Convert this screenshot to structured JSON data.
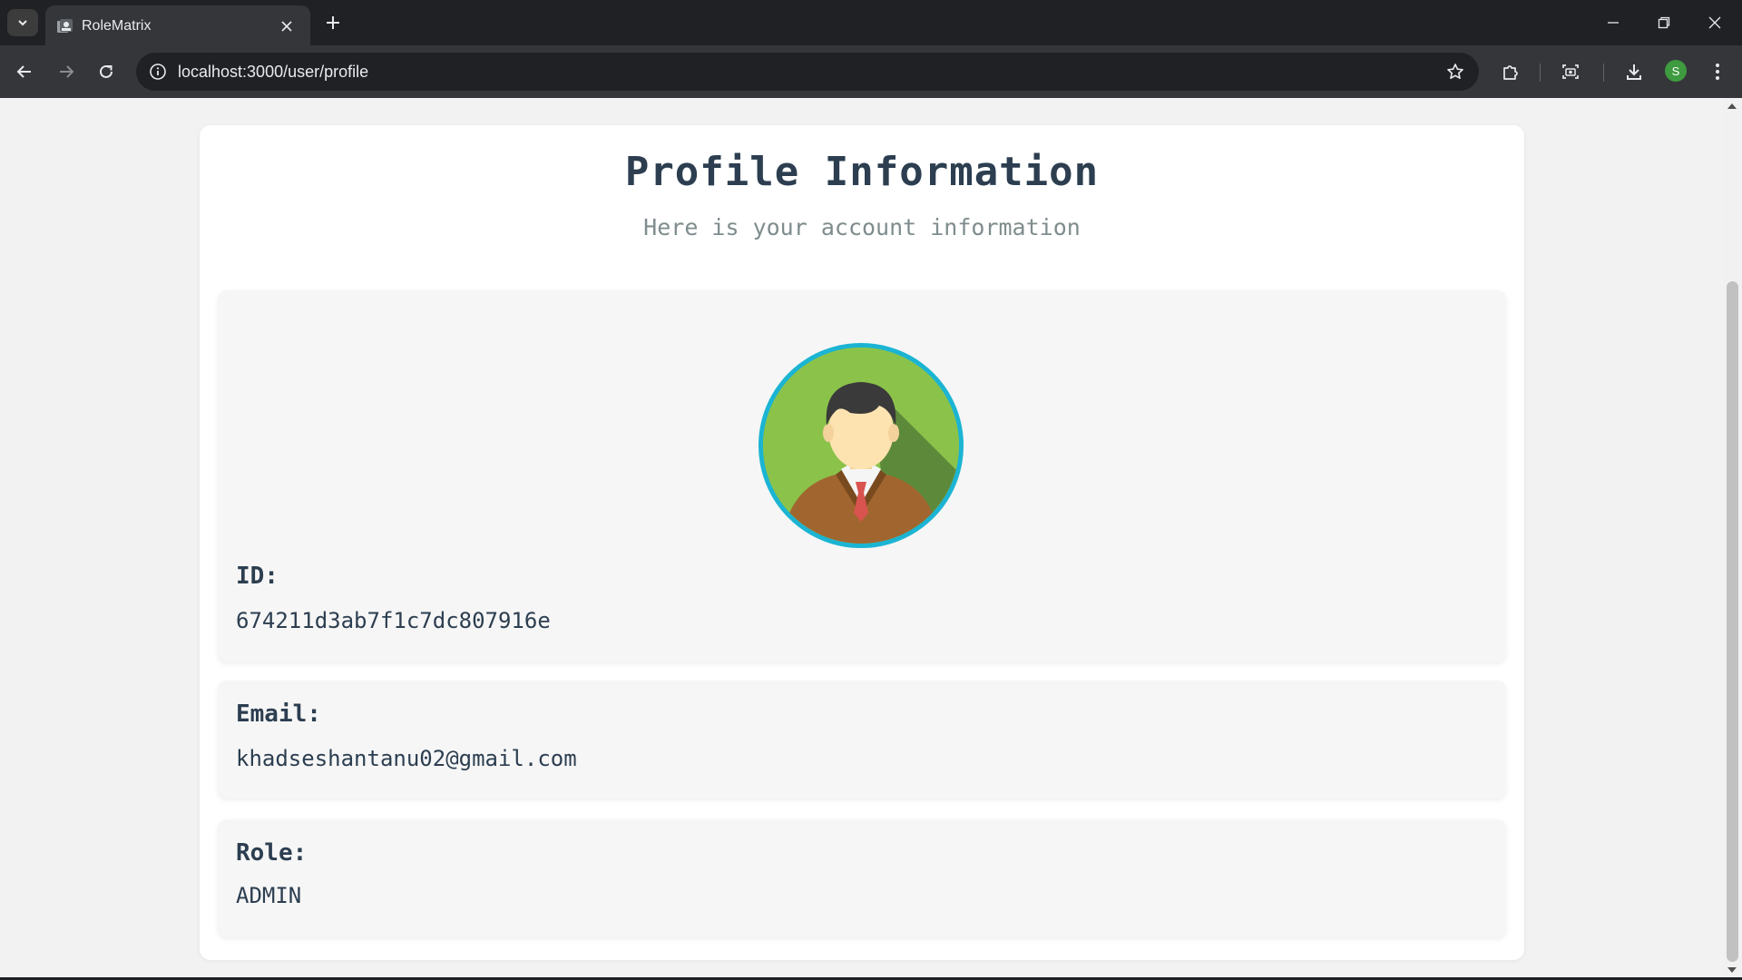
{
  "browser": {
    "tab_title": "RoleMatrix",
    "url": "localhost:3000/user/profile",
    "profile_initial": "S"
  },
  "colors": {
    "accent": "#1bb4d3",
    "title": "#2c3e50",
    "subtitle": "#7f8c8d",
    "card_bg": "#ffffff",
    "box_bg": "#f6f6f6"
  },
  "profile": {
    "title": "Profile Information",
    "subtitle": "Here is your account information",
    "avatar_icon": "user-avatar-icon",
    "fields": {
      "id_label": "ID:",
      "id_value": "674211d3ab7f1c7dc807916e",
      "email_label": "Email:",
      "email_value": "khadseshantanu02@gmail.com",
      "role_label": "Role:",
      "role_value": "ADMIN"
    }
  }
}
